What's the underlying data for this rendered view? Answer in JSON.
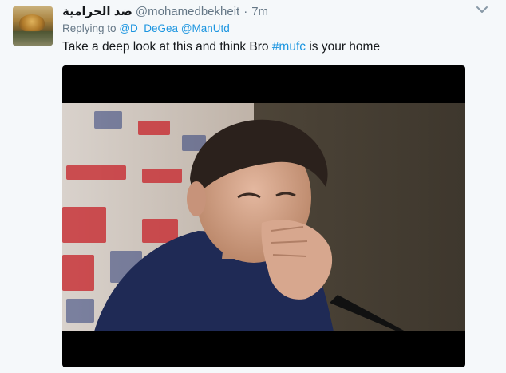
{
  "tweet": {
    "display_name": "ضد الحرامية",
    "screen_name": "@mohamedbekheit",
    "separator": "·",
    "timestamp": "7m",
    "reply_prefix": "Replying to",
    "reply_mentions": [
      "@D_DeGea",
      "@ManUtd"
    ],
    "text_before": "Take a deep look at this and think Bro ",
    "hashtag": "#mufc",
    "text_after": " is your home"
  },
  "icons": {
    "caret": "chevron-down-icon"
  },
  "colors": {
    "background": "#f5f8fa",
    "link": "#1b95e0",
    "muted": "#657786",
    "text": "#14171a"
  }
}
